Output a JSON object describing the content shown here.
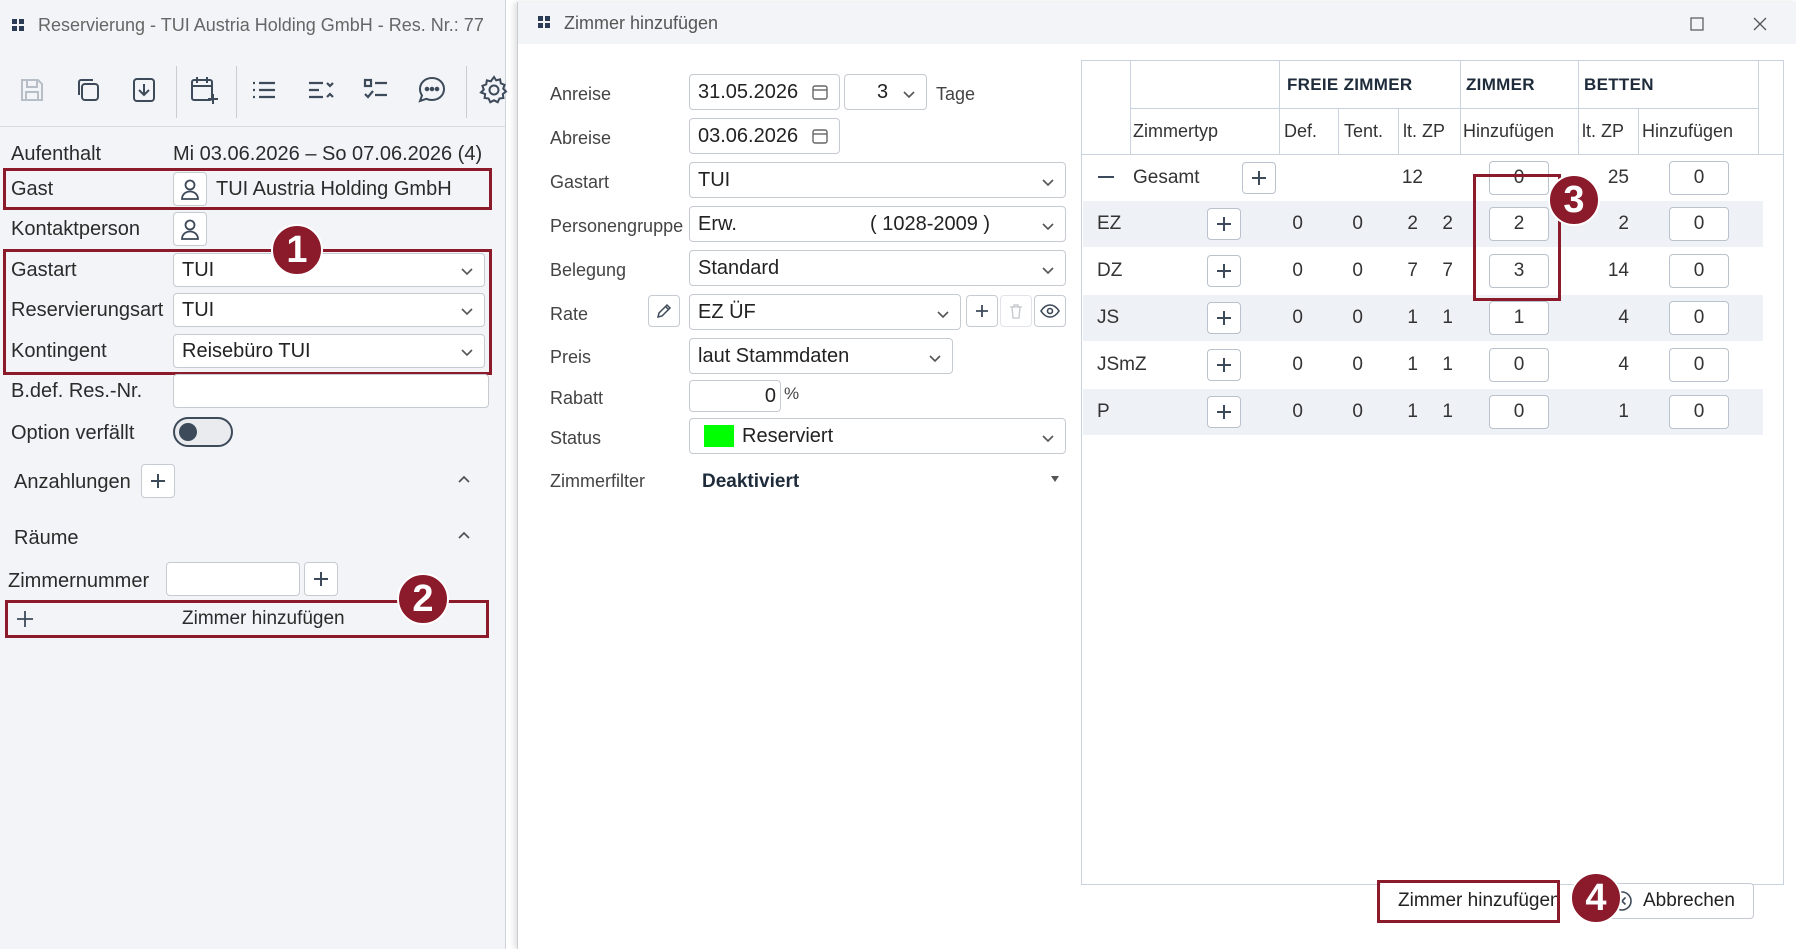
{
  "background": {
    "title": "Reservierung - TUI Austria Holding GmbH - Res. Nr.: 77",
    "toolbar_icons": [
      "save-icon",
      "copy-icon",
      "download-icon",
      "calendar-add-icon",
      "list-icon",
      "sort-list-icon",
      "checklist-icon",
      "chat-icon",
      "gear-icon"
    ],
    "aufenthalt": {
      "label": "Aufenthalt",
      "value": "Mi 03.06.2026 – So 07.06.2026 (4)"
    },
    "gast": {
      "label": "Gast",
      "value": "TUI Austria Holding GmbH"
    },
    "kontaktperson": {
      "label": "Kontaktperson"
    },
    "gastart": {
      "label": "Gastart",
      "value": "TUI"
    },
    "reservierungsart": {
      "label": "Reservierungsart",
      "value": "TUI"
    },
    "kontingent": {
      "label": "Kontingent",
      "value": "Reisebüro TUI"
    },
    "bdef": {
      "label": "B.def. Res.-Nr.",
      "value": ""
    },
    "option": {
      "label": "Option verfällt"
    },
    "anzahlungen": {
      "label": "Anzahlungen"
    },
    "raeume": {
      "label": "Räume"
    },
    "zimmernummer": {
      "label": "Zimmernummer",
      "value": ""
    },
    "add_room_button": "Zimmer hinzufügen"
  },
  "badges": [
    "1",
    "2",
    "3",
    "4"
  ],
  "dialog": {
    "title": "Zimmer hinzufügen",
    "anreise": {
      "label": "Anreise",
      "value": "31.05.2026"
    },
    "tage": {
      "value": "3",
      "unit": "Tage"
    },
    "abreise": {
      "label": "Abreise",
      "value": "03.06.2026"
    },
    "gastart": {
      "label": "Gastart",
      "value": "TUI"
    },
    "personengruppe": {
      "label": "Personengruppe",
      "value": "Erw.",
      "range": "( 1028-2009 )"
    },
    "belegung": {
      "label": "Belegung",
      "value": "Standard"
    },
    "rate": {
      "label": "Rate",
      "value": "EZ ÜF"
    },
    "preis": {
      "label": "Preis",
      "value": "laut Stammdaten"
    },
    "rabatt": {
      "label": "Rabatt",
      "value": "0",
      "unit": "%"
    },
    "status": {
      "label": "Status",
      "value": "Reserviert",
      "color": "#00ff00"
    },
    "zimmerfilter": {
      "label": "Zimmerfilter",
      "value": "Deaktiviert"
    },
    "grid": {
      "group_headers": {
        "freie": "FREIE ZIMMER",
        "zimmer": "ZIMMER",
        "betten": "BETTEN"
      },
      "columns": {
        "zimmertyp": "Zimmertyp",
        "def": "Def.",
        "tent": "Tent.",
        "ltzp": "lt. ZP",
        "hinzufuegen": "Hinzufügen",
        "ltzp_betten": "lt. ZP",
        "hinzufuegen_betten": "Hinzufügen"
      },
      "total": {
        "label": "Gesamt",
        "ltzp": "12",
        "add": "0",
        "betten": "25",
        "betten_add": "0"
      },
      "rows": [
        {
          "type": "EZ",
          "def": "0",
          "tent": "0",
          "ltzp": "2",
          "free": "2",
          "add": "2",
          "betten": "2",
          "betten_add": "0"
        },
        {
          "type": "DZ",
          "def": "0",
          "tent": "0",
          "ltzp": "7",
          "free": "7",
          "add": "3",
          "betten": "14",
          "betten_add": "0"
        },
        {
          "type": "JS",
          "def": "0",
          "tent": "0",
          "ltzp": "1",
          "free": "1",
          "add": "1",
          "betten": "4",
          "betten_add": "0"
        },
        {
          "type": "JSmZ",
          "def": "0",
          "tent": "0",
          "ltzp": "1",
          "free": "1",
          "add": "0",
          "betten": "4",
          "betten_add": "0"
        },
        {
          "type": "P",
          "def": "0",
          "tent": "0",
          "ltzp": "1",
          "free": "1",
          "add": "0",
          "betten": "1",
          "betten_add": "0"
        }
      ]
    },
    "buttons": {
      "add": "Zimmer hinzufügen",
      "cancel": "Abbrechen"
    }
  }
}
